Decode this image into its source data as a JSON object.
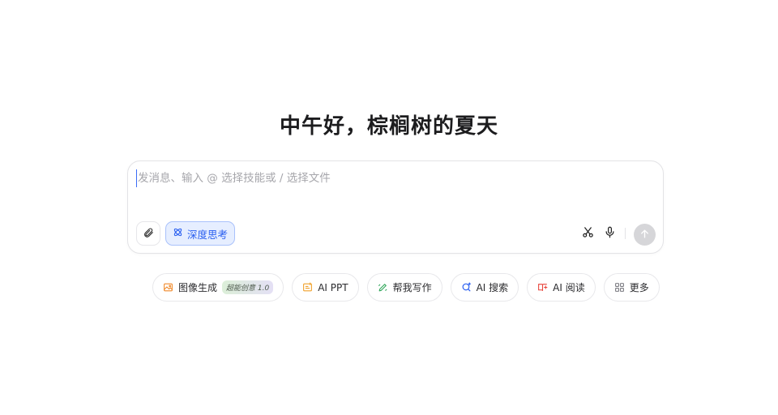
{
  "greeting": "中午好，棕榈树的夏天",
  "composer": {
    "placeholder": "发消息、输入 @ 选择技能或 / 选择文件",
    "value": "",
    "deep_think_label": "深度思考"
  },
  "chips": [
    {
      "label": "图像生成",
      "badge": "超能创意 1.0",
      "icon": "image-gen-icon",
      "color": "#f08a2b"
    },
    {
      "label": "AI PPT",
      "icon": "ppt-icon",
      "color": "#f0a12b"
    },
    {
      "label": "帮我写作",
      "icon": "pen-icon",
      "color": "#2fa65a"
    },
    {
      "label": "AI 搜索",
      "icon": "search-icon",
      "color": "#2a5ff0"
    },
    {
      "label": "AI 阅读",
      "icon": "reading-icon",
      "color": "#e8453c"
    },
    {
      "label": "更多",
      "icon": "grid-icon",
      "color": "#7a7a80"
    }
  ],
  "colors": {
    "accent": "#2a5ff0",
    "send_disabled": "#d6d6d9"
  }
}
